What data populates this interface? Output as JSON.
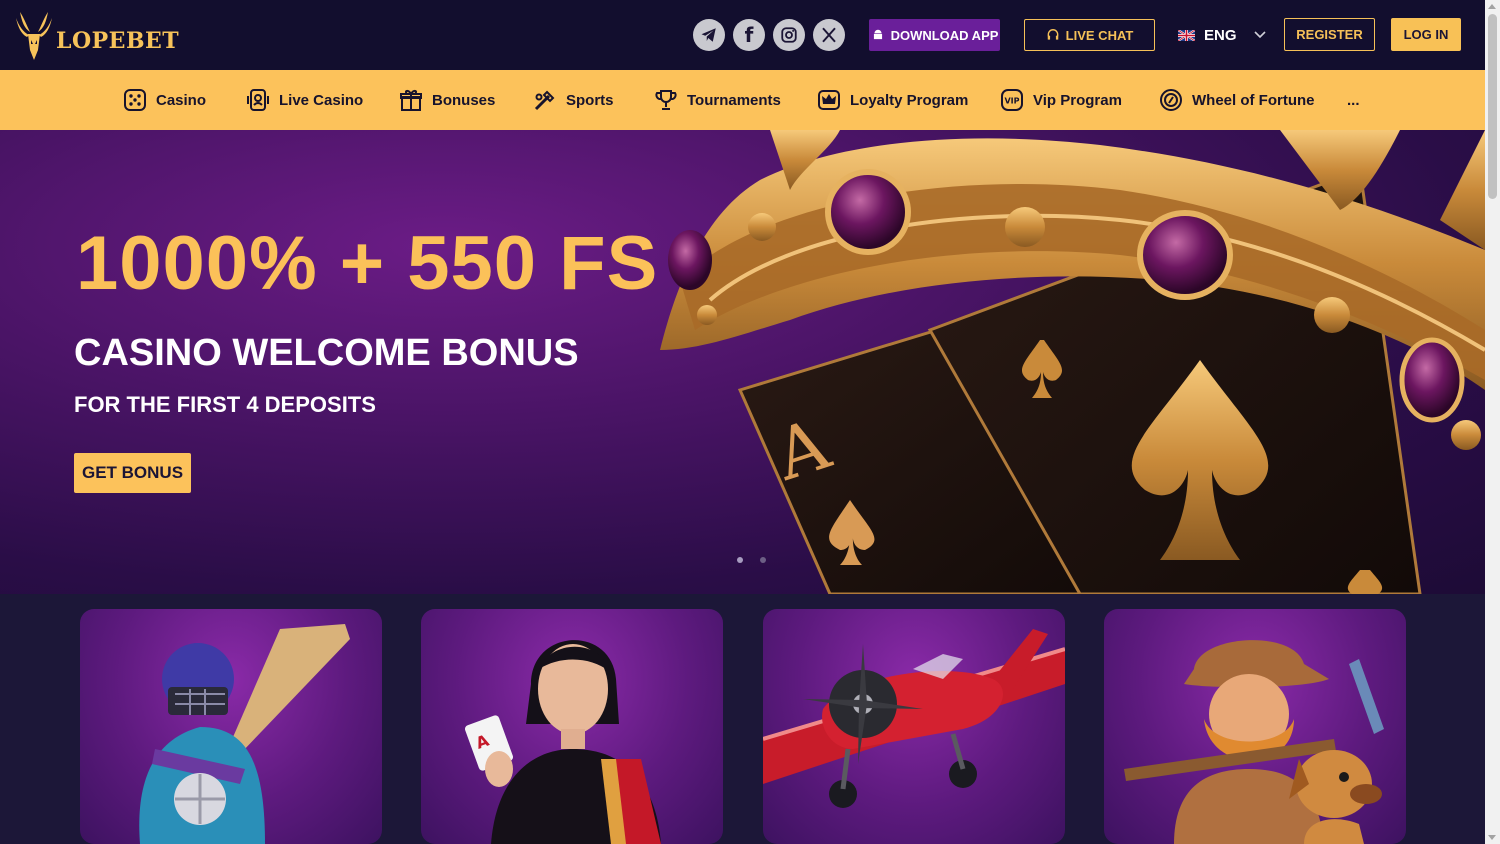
{
  "header": {
    "brand": "LOPEBET",
    "socials": [
      {
        "icon": "telegram-icon"
      },
      {
        "icon": "facebook-icon",
        "glyph": "f"
      },
      {
        "icon": "instagram-icon"
      },
      {
        "icon": "x-twitter-icon"
      }
    ],
    "download_label": "DOWNLOAD APP",
    "livechat_label": "LIVE CHAT",
    "language": "ENG",
    "register_label": "REGISTER",
    "login_label": "LOG IN"
  },
  "nav": {
    "items": [
      {
        "label": "Casino",
        "icon": "dice-icon"
      },
      {
        "label": "Live Casino",
        "icon": "live-casino-icon"
      },
      {
        "label": "Bonuses",
        "icon": "gift-icon"
      },
      {
        "label": "Sports",
        "icon": "sports-icon"
      },
      {
        "label": "Tournaments",
        "icon": "trophy-icon"
      },
      {
        "label": "Loyalty Program",
        "icon": "crown-icon"
      },
      {
        "label": "Vip Program",
        "icon": "vip-icon"
      },
      {
        "label": "Wheel of Fortune",
        "icon": "wheel-icon"
      }
    ],
    "more_label": "..."
  },
  "hero": {
    "headline": "1000% + 550 FS",
    "title": "CASINO WELCOME BONUS",
    "subtitle": "FOR THE FIRST 4 DEPOSITS",
    "cta_label": "GET BONUS",
    "slides_total": 2,
    "active_slide": 1
  },
  "cards": [
    {
      "image": "cricket-player"
    },
    {
      "image": "live-dealer"
    },
    {
      "image": "aviator-plane"
    },
    {
      "image": "gold-miner"
    }
  ],
  "colors": {
    "accent_gold": "#fcc25b",
    "header_bg": "#120e2e",
    "purple_button": "#6a1f9a"
  }
}
